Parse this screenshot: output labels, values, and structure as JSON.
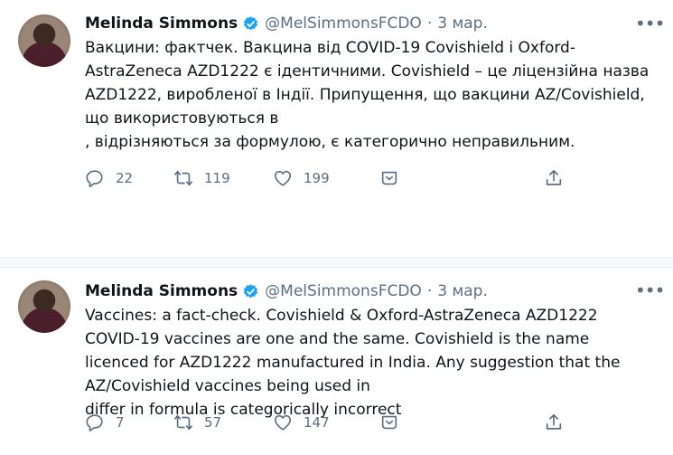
{
  "colors": {
    "accent": "#1da1f2",
    "text": "#0f1419",
    "muted": "#5b7083",
    "flag_blue": "#1f6fd6",
    "flag_yellow": "#ffd41c"
  },
  "tweets": [
    {
      "name": "Melinda Simmons",
      "handle": "@MelSimmonsFCDO",
      "separator": "·",
      "date": "3 мар.",
      "text_before_flag": "Вакцини: фактчек. Вакцина від COVID-19 Covishield і Oxford-AstraZeneca AZD1222 є ідентичними. Covishield – це ліцензійна назва AZD1222, виробленої в Індії. Припущення, що вакцини AZ/Covishield, що використовуються в",
      "text_after_flag": ", відрізняються за формулою, є категорично неправильним.",
      "flag_icon": "ukraine-flag-icon",
      "replies": "22",
      "retweets": "119",
      "likes": "199"
    },
    {
      "name": "Melinda Simmons",
      "handle": "@MelSimmonsFCDO",
      "separator": "·",
      "date": "3 мар.",
      "text_before_flag": "Vaccines: a fact-check. Covishield & Oxford-AstraZeneca AZD1222 COVID-19 vaccines are one and the same. Covishield is the name licenced for AZD1222 manufactured in India. Any suggestion that the AZ/Covishield vaccines being used in",
      "text_after_flag": " differ in formula is categorically incorrect",
      "flag_icon": "ukraine-flag-icon",
      "replies": "7",
      "retweets": "57",
      "likes": "147"
    }
  ],
  "icons": [
    "verified-badge-icon",
    "more-icon",
    "reply-icon",
    "retweet-icon",
    "like-icon",
    "share-dropdown-icon",
    "share-icon"
  ]
}
